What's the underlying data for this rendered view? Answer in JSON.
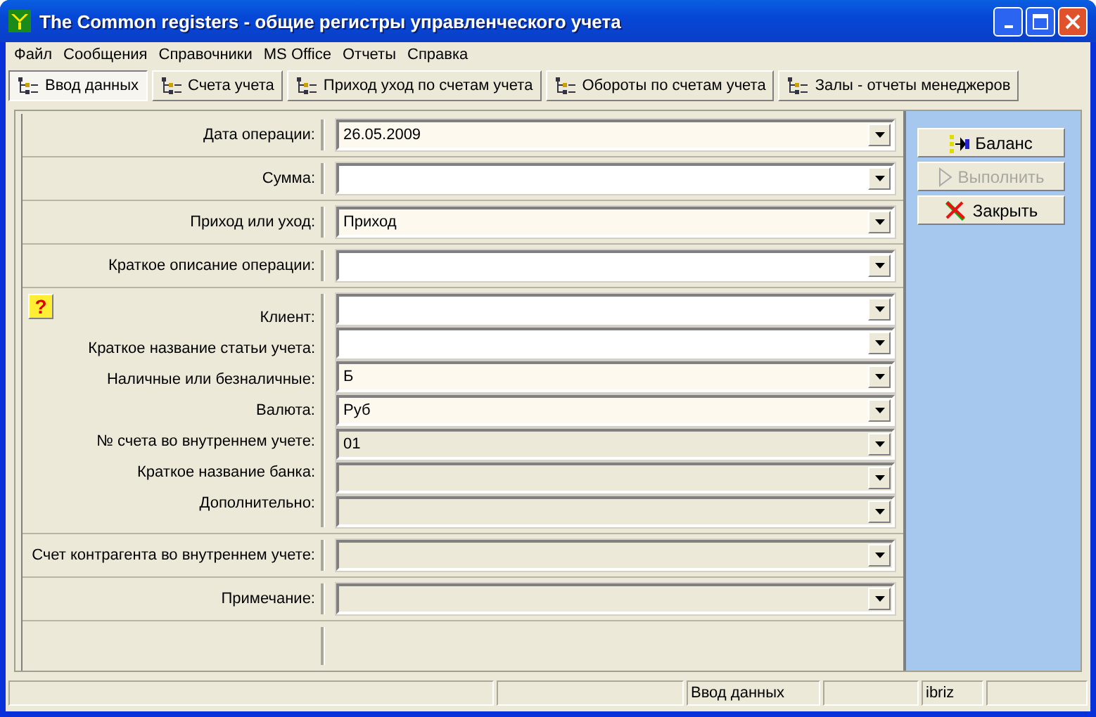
{
  "window": {
    "title": "The Common registers  - общие регистры управленческого учета"
  },
  "menu": [
    "Файл",
    "Сообщения",
    "Справочники",
    "MS Office",
    "Отчеты",
    "Справка"
  ],
  "toolbar": [
    {
      "label": "Ввод данных",
      "selected": true
    },
    {
      "label": "Счета учета",
      "selected": false
    },
    {
      "label": "Приход уход по счетам учета",
      "selected": false
    },
    {
      "label": "Обороты по счетам учета",
      "selected": false
    },
    {
      "label": "Залы - отчеты менеджеров",
      "selected": false
    }
  ],
  "form_groups": [
    {
      "fields": [
        {
          "label": "Дата операции:",
          "value": "26.05.2009",
          "disabled": false
        }
      ]
    },
    {
      "fields": [
        {
          "label": "Сумма:",
          "disabled": false
        }
      ]
    },
    {
      "fields": [
        {
          "label": "Приход или уход:",
          "value": "Приход",
          "disabled": false
        }
      ]
    },
    {
      "fields": [
        {
          "label": "Краткое описание операции:",
          "disabled": false
        }
      ]
    },
    {
      "help": "?",
      "fields": [
        {
          "label": "Клиент:",
          "disabled": false
        },
        {
          "label": "Краткое название статьи учета:",
          "disabled": false
        },
        {
          "label": "Наличные или безналичные:",
          "value": "Б",
          "disabled": false
        },
        {
          "label": "Валюта:",
          "value": "Руб",
          "disabled": false
        },
        {
          "label": "№ счета во внутреннем учете:",
          "value": "01",
          "disabled": true
        },
        {
          "label": "Краткое название банка:",
          "disabled": true
        },
        {
          "label": "Дополнительно:",
          "disabled": true
        }
      ]
    },
    {
      "fields": [
        {
          "label": "Счет контрагента во внутреннем учете:",
          "disabled": true
        }
      ]
    },
    {
      "fields": [
        {
          "label": "Примечание:",
          "disabled": true
        }
      ]
    }
  ],
  "actions": [
    {
      "kind": "balance",
      "label": "Баланс",
      "disabled": false
    },
    {
      "kind": "run",
      "label": "Выполнить",
      "disabled": true
    },
    {
      "kind": "close",
      "label": "Закрыть",
      "disabled": false
    }
  ],
  "status_bar": {
    "mode": "Ввод данных",
    "user": "ibriz"
  }
}
